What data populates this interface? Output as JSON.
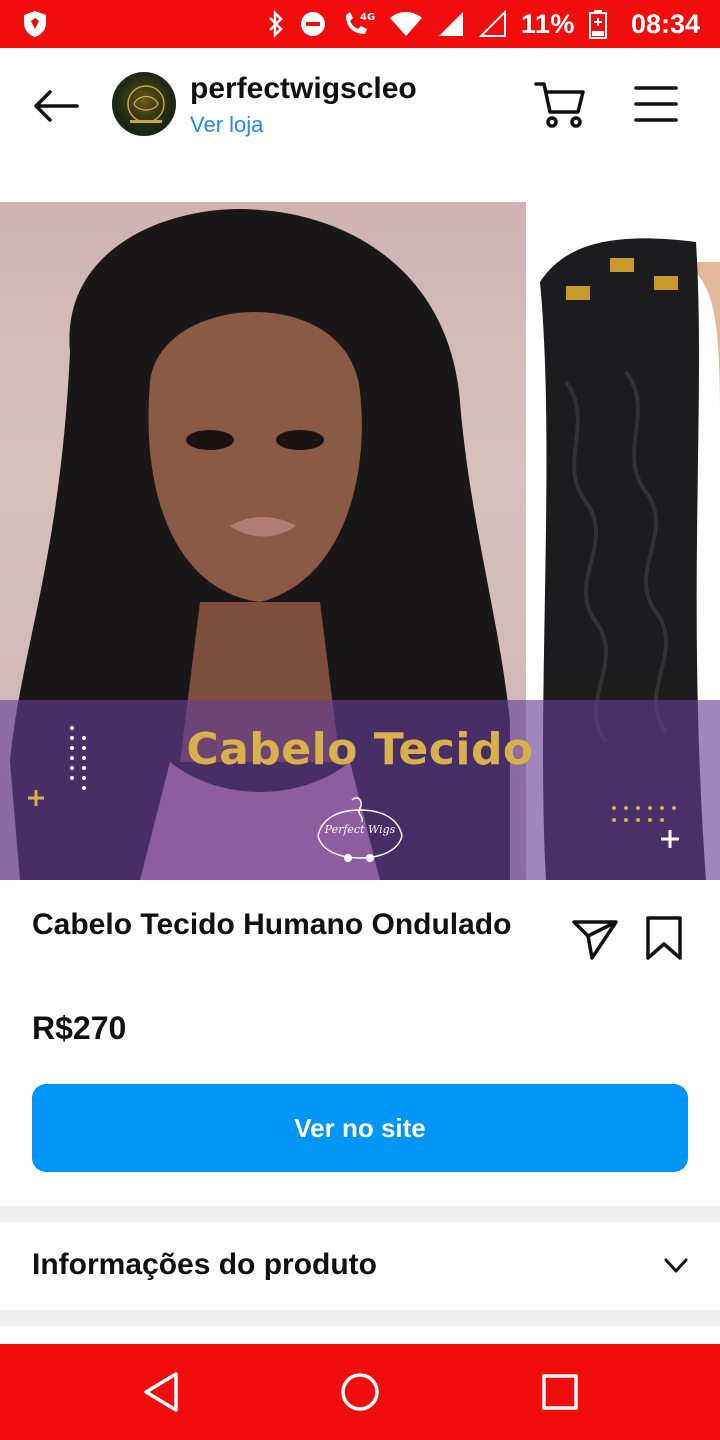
{
  "status_bar": {
    "battery_percent": "11%",
    "time": "08:34",
    "network_badge": "4G",
    "icons": [
      "shield-app-icon",
      "bluetooth-icon",
      "do-not-disturb-icon",
      "call-4g-icon",
      "wifi-icon",
      "signal-icon",
      "signal-empty-icon",
      "battery-low-icon"
    ],
    "background": "#f20d0d"
  },
  "header": {
    "shop_name": "perfectwigscleo",
    "view_store": "Ver loja",
    "icons": [
      "back-arrow-icon",
      "cart-icon",
      "menu-icon"
    ]
  },
  "hero": {
    "banner_title": "Cabelo Tecido",
    "logo_text": "Perfect Wigs"
  },
  "product": {
    "title": "Cabelo Tecido Humano Ondulado",
    "price": "R$270",
    "cta_label": "Ver no site",
    "icons": [
      "share-icon",
      "bookmark-icon"
    ]
  },
  "sections": {
    "product_info_label": "Informações do produto"
  },
  "colors": {
    "accent": "#0095f6",
    "system_bar": "#f20d0d",
    "banner_overlay": "#643e96",
    "banner_gold": "#d9b14c"
  },
  "nav": {
    "icons": [
      "nav-back-icon",
      "nav-home-icon",
      "nav-recent-apps-icon"
    ]
  }
}
